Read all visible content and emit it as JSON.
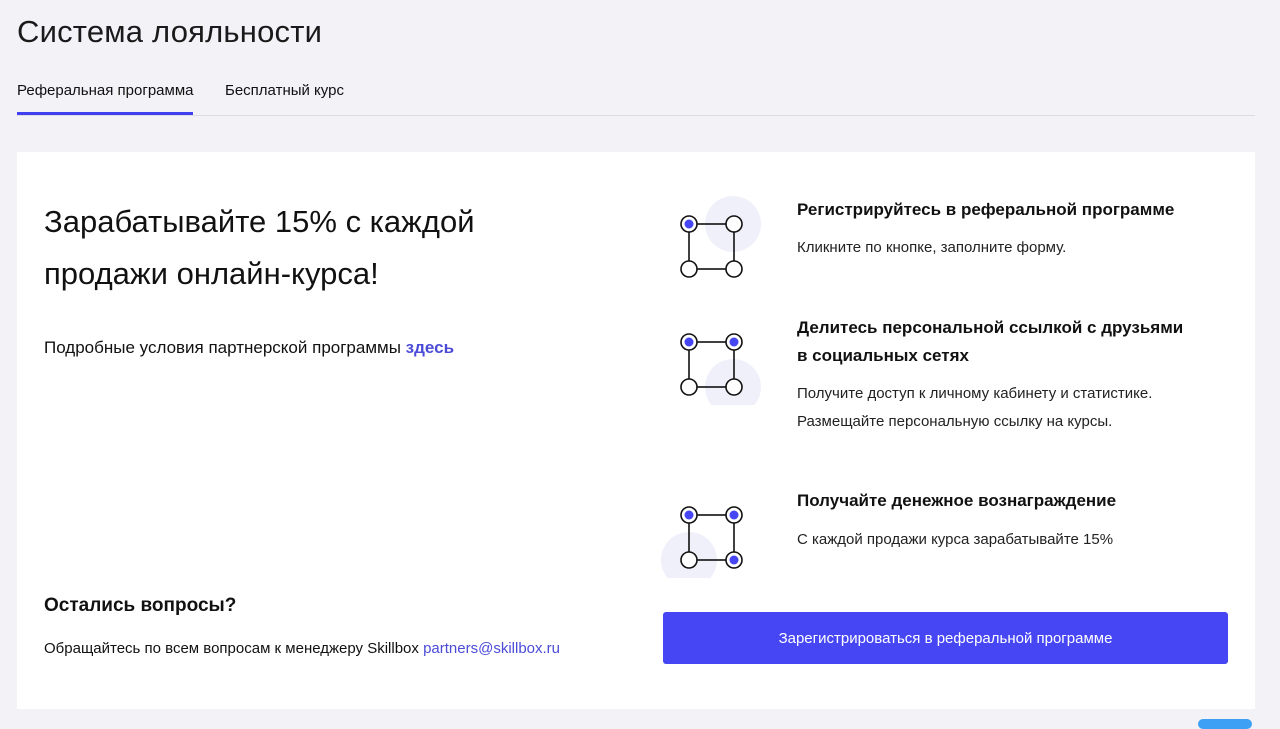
{
  "page": {
    "title": "Система лояльности"
  },
  "tabs": [
    {
      "label": "Реферальная программа",
      "active": true
    },
    {
      "label": "Бесплатный курс",
      "active": false
    }
  ],
  "hero": {
    "headline_line1": "Зарабатывайте 15% с каждой",
    "headline_line2": "продажи онлайн-курса!",
    "conditions_text": "Подробные условия партнерской программы ",
    "conditions_link": "здесь"
  },
  "questions": {
    "title": "Остались вопросы?",
    "text": "Обращайтесь по всем вопросам к менеджеру Skillbox ",
    "email": "partners@skillbox.ru"
  },
  "steps": [
    {
      "icon": "square-nodes-1-icon",
      "title_line1": "Регистрируйтесь в реферальной программе",
      "title_line2": "",
      "desc_line1": "Кликните по кнопке, заполните форму.",
      "desc_line2": ""
    },
    {
      "icon": "square-nodes-2-icon",
      "title_line1": "Делитесь персональной ссылкой с друзьями",
      "title_line2": "в социальных сетях",
      "desc_line1": "Получите доступ к личному кабинету и статистике.",
      "desc_line2": "Размещайте персональную ссылку на курсы."
    },
    {
      "icon": "square-nodes-3-icon",
      "title_line1": "Получайте денежное вознаграждение",
      "title_line2": "",
      "desc_line1": "С каждой продажи курса зарабатывайте 15%",
      "desc_line2": ""
    }
  ],
  "cta": {
    "label": "Зарегистрироваться в реферальной программе"
  },
  "colors": {
    "accent": "#4646f5",
    "link": "#4b4bd8",
    "background": "#f2f2f7",
    "icon_halo": "#f0f0fb"
  }
}
